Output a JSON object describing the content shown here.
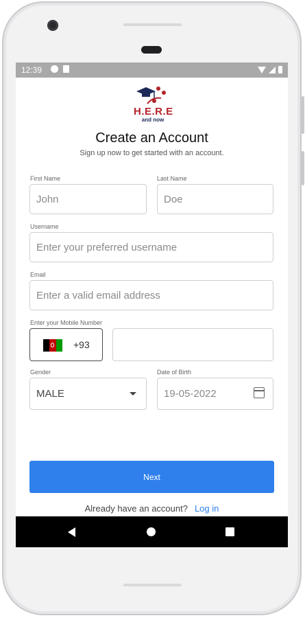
{
  "status_bar": {
    "time": "12:39",
    "icons": [
      "google-icon",
      "sd-card-icon",
      "wifi-icon",
      "signal-icon",
      "battery-icon"
    ]
  },
  "logo": {
    "text": "H.E.R.E",
    "subtext": "and now",
    "colors": {
      "red": "#b3232b",
      "navy": "#1d2a59"
    }
  },
  "header": {
    "title": "Create an Account",
    "subtitle": "Sign up now to get started with an account."
  },
  "form": {
    "first_name": {
      "label": "First Name",
      "placeholder": "John"
    },
    "last_name": {
      "label": "Last Name",
      "placeholder": "Doe"
    },
    "username": {
      "label": "Username",
      "placeholder": "Enter your preferred username"
    },
    "email": {
      "label": "Email",
      "placeholder": "Enter a valid email address"
    },
    "mobile": {
      "label": "Enter your Mobile Number",
      "country_code": "+93",
      "flag": "afghanistan-flag-icon",
      "value": ""
    },
    "gender": {
      "label": "Gender",
      "value": "MALE"
    },
    "dob": {
      "label": "Date of Birth",
      "value": "19-05-2022"
    }
  },
  "actions": {
    "next_label": "Next",
    "login_prompt": "Already have an account?",
    "login_link": "Log in",
    "accent_color": "#2f80ed"
  },
  "nav_bar": {
    "icons": [
      "back-icon",
      "home-icon",
      "recents-icon"
    ]
  }
}
